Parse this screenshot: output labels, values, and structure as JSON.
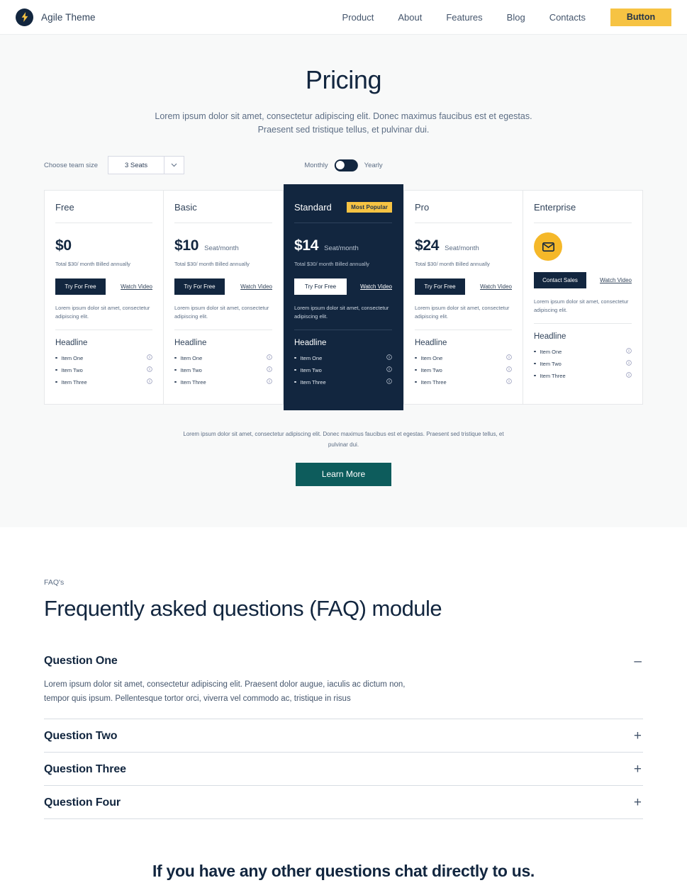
{
  "header": {
    "brand_name": "Agile Theme",
    "logo_icon": "lightning-bolt-icon",
    "nav": [
      {
        "label": "Product"
      },
      {
        "label": "About"
      },
      {
        "label": "Features"
      },
      {
        "label": "Blog"
      },
      {
        "label": "Contacts"
      }
    ],
    "cta_label": "Button",
    "cta_color": "#f6c343"
  },
  "pricing": {
    "title": "Pricing",
    "subtitle": "Lorem ipsum dolor sit amet, consectetur adipiscing elit. Donec maximus faucibus est et egestas. Praesent sed tristique tellus, et pulvinar dui.",
    "controls": {
      "team_size_label": "Choose team size",
      "team_size_value": "3 Seats",
      "team_size_caret_icon": "chevron-down-icon",
      "billing_left": "Monthly",
      "billing_right": "Yearly",
      "billing_selected": "Monthly"
    },
    "plans": [
      {
        "name": "Free",
        "badge": "",
        "price": "$0",
        "price_unit": "",
        "billed": "Total $30/ month Billed annually",
        "cta_label": "Try For Free",
        "video_label": "Watch Video",
        "blurb": "Lorem ipsum dolor sit amet, consectetur adipiscing elit.",
        "headline": "Headline",
        "features": [
          "Item One",
          "Item Two",
          "Item Three"
        ],
        "featured": false,
        "icon": ""
      },
      {
        "name": "Basic",
        "badge": "",
        "price": "$10",
        "price_unit": "Seat/month",
        "billed": "Total $30/ month Billed annually",
        "cta_label": "Try For Free",
        "video_label": "Watch Video",
        "blurb": "Lorem ipsum dolor sit amet, consectetur adipiscing elit.",
        "headline": "Headline",
        "features": [
          "Item One",
          "Item Two",
          "Item Three"
        ],
        "featured": false,
        "icon": ""
      },
      {
        "name": "Standard",
        "badge": "Most Popular",
        "price": "$14",
        "price_unit": "Seat/month",
        "billed": "Total $30/ month Billed annually",
        "cta_label": "Try For Free",
        "video_label": "Watch Video",
        "blurb": "Lorem ipsum dolor sit amet, consectetur adipiscing elit.",
        "headline": "Headline",
        "features": [
          "Item One",
          "Item Two",
          "Item Three"
        ],
        "featured": true,
        "icon": ""
      },
      {
        "name": "Pro",
        "badge": "",
        "price": "$24",
        "price_unit": "Seat/month",
        "billed": "Total $30/ month Billed annually",
        "cta_label": "Try For Free",
        "video_label": "Watch Video",
        "blurb": "Lorem ipsum dolor sit amet, consectetur adipiscing elit.",
        "headline": "Headline",
        "features": [
          "Item One",
          "Item Two",
          "Item Three"
        ],
        "featured": false,
        "icon": ""
      },
      {
        "name": "Enterprise",
        "badge": "",
        "price": "",
        "price_unit": "",
        "billed": "",
        "cta_label": "Contact Sales",
        "video_label": "Watch Video",
        "blurb": "Lorem ipsum dolor sit amet, consectetur adipiscing elit.",
        "headline": "Headline",
        "features": [
          "Item One",
          "Item Two",
          "Item Three"
        ],
        "featured": false,
        "icon": "envelope-icon"
      }
    ],
    "footnote": "Lorem ipsum dolor sit amet, consectetur adipiscing elit. Donec maximus faucibus est et egestas. Praesent sed tristique tellus, et pulvinar dui.",
    "learn_more_label": "Learn More",
    "learn_more_color": "#0d5c5c"
  },
  "faq": {
    "eyebrow": "FAQ's",
    "title": "Frequently asked questions (FAQ) module",
    "items": [
      {
        "question": "Question One",
        "answer": "Lorem ipsum dolor sit amet, consectetur adipiscing elit. Praesent dolor augue, iaculis ac dictum non, tempor quis ipsum. Pellentesque tortor orci, viverra vel commodo ac, tristique in risus",
        "open": true,
        "sign": "–"
      },
      {
        "question": "Question Two",
        "answer": "",
        "open": false,
        "sign": "+"
      },
      {
        "question": "Question Three",
        "answer": "",
        "open": false,
        "sign": "+"
      },
      {
        "question": "Question Four",
        "answer": "",
        "open": false,
        "sign": "+"
      }
    ],
    "chat_line": "If you have any other questions chat directly to us."
  }
}
